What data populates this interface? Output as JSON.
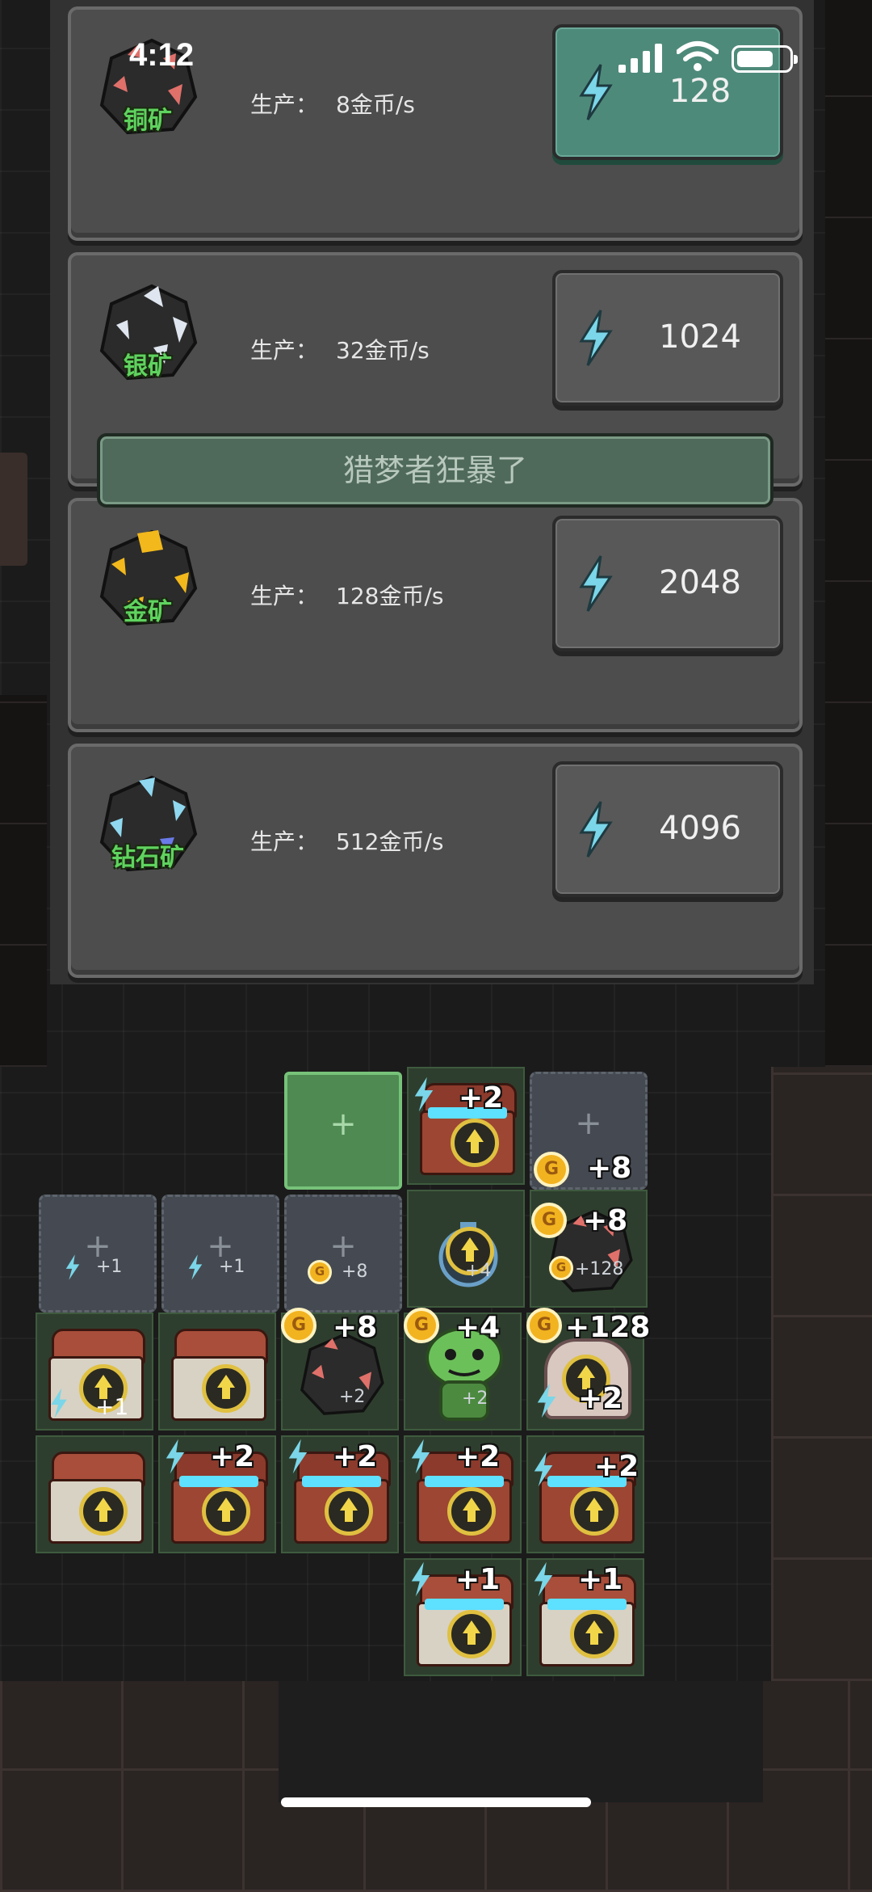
{
  "status_bar": {
    "time": "4:12"
  },
  "panel": {
    "production_label": "生产：",
    "banner": "猎梦者狂暴了",
    "mines": [
      {
        "name": "铜矿",
        "rate": "8金币/s",
        "cost": "128",
        "active": true,
        "ore_color": "#e0706a"
      },
      {
        "name": "银矿",
        "rate": "32金币/s",
        "cost": "1024",
        "active": false,
        "ore_color": "#dfe6ef"
      },
      {
        "name": "金矿",
        "rate": "128金币/s",
        "cost": "2048",
        "active": false,
        "ore_color": "#f2b81c"
      },
      {
        "name": "钻石矿",
        "rate": "512金币/s",
        "cost": "4096",
        "active": false,
        "ore_color": "#8fd8f0"
      }
    ]
  },
  "board": {
    "labels": {
      "r0c3": "+2",
      "r0c4": "+8",
      "r1c0": "+1",
      "r1c1": "+1",
      "r1c2": "+8",
      "r1c3": "+4",
      "r1c4_big": "+8",
      "r1c4_small": "+128",
      "r2c0": "+1",
      "r2c2_big": "+8",
      "r2c2_small": "+2",
      "r2c3_big": "+4",
      "r2c3_small": "+2",
      "r2c4_big": "+128",
      "r2c4_small": "+2",
      "r3c1": "+2",
      "r3c2": "+2",
      "r3c3": "+2",
      "r3c4": "+2",
      "r4c3": "+1",
      "r4c4": "+1"
    },
    "coin_letter": "G"
  }
}
